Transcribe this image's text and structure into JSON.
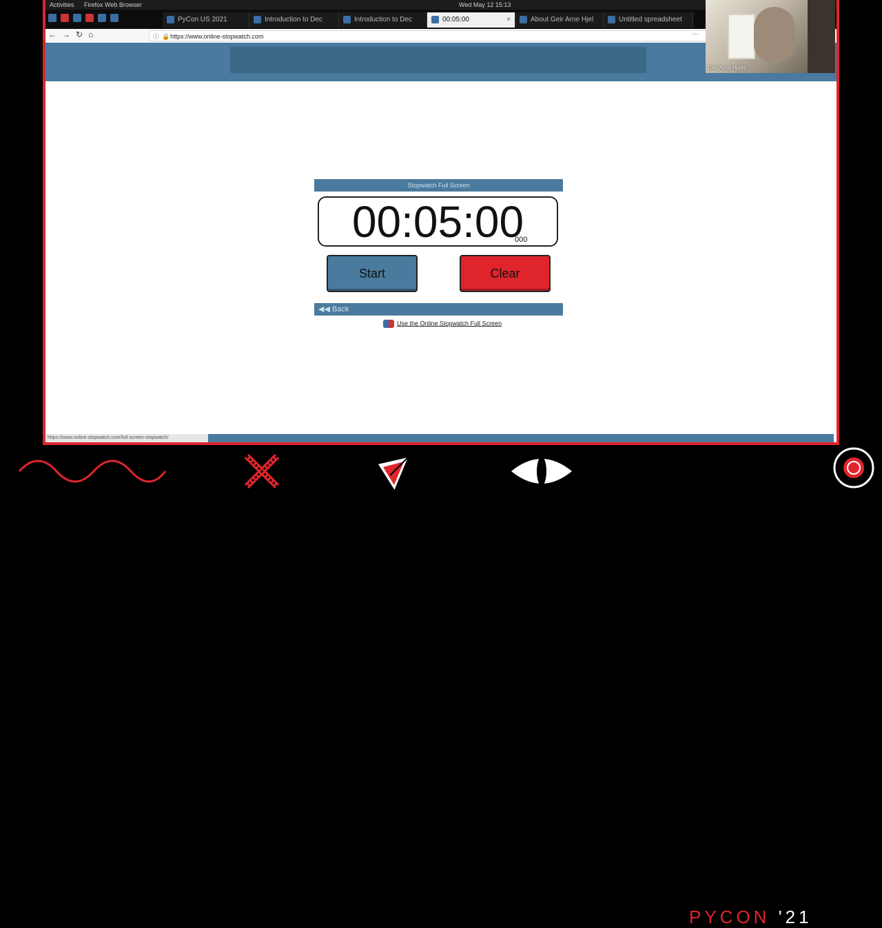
{
  "system_bar": {
    "activities": "Activities",
    "app": "Firefox Web Browser",
    "clock": "Wed May 12 15:13"
  },
  "tabs": [
    {
      "label": "PyCon US 2021"
    },
    {
      "label": "Introduction to Dec"
    },
    {
      "label": "Introduction to Dec"
    },
    {
      "label": "00:05:00"
    },
    {
      "label": "About Geir Arne Hjel"
    },
    {
      "label": "Untitled spreadsheet"
    }
  ],
  "tab_close": "×",
  "address_bar": {
    "url": "https://www.online-stopwatch.com",
    "more": "···"
  },
  "webcam": {
    "name": "Geir Arne Hjelle"
  },
  "stopwatch": {
    "header": "Stopwatch Full Screen",
    "time": "00:05:00",
    "milliseconds": "000",
    "start_label": "Start",
    "clear_label": "Clear",
    "back_label": "Back",
    "fullscreen_link": "Use the Online Stopwatch Full Screen"
  },
  "status_url": "https://www.online-stopwatch.com/full-screen-stopwatch/",
  "branding": {
    "name": "PYCON",
    "year": "'21"
  },
  "colors": {
    "frame": "#e0242c",
    "site_blue": "#4a7a9e",
    "clear_red": "#e0242c"
  }
}
